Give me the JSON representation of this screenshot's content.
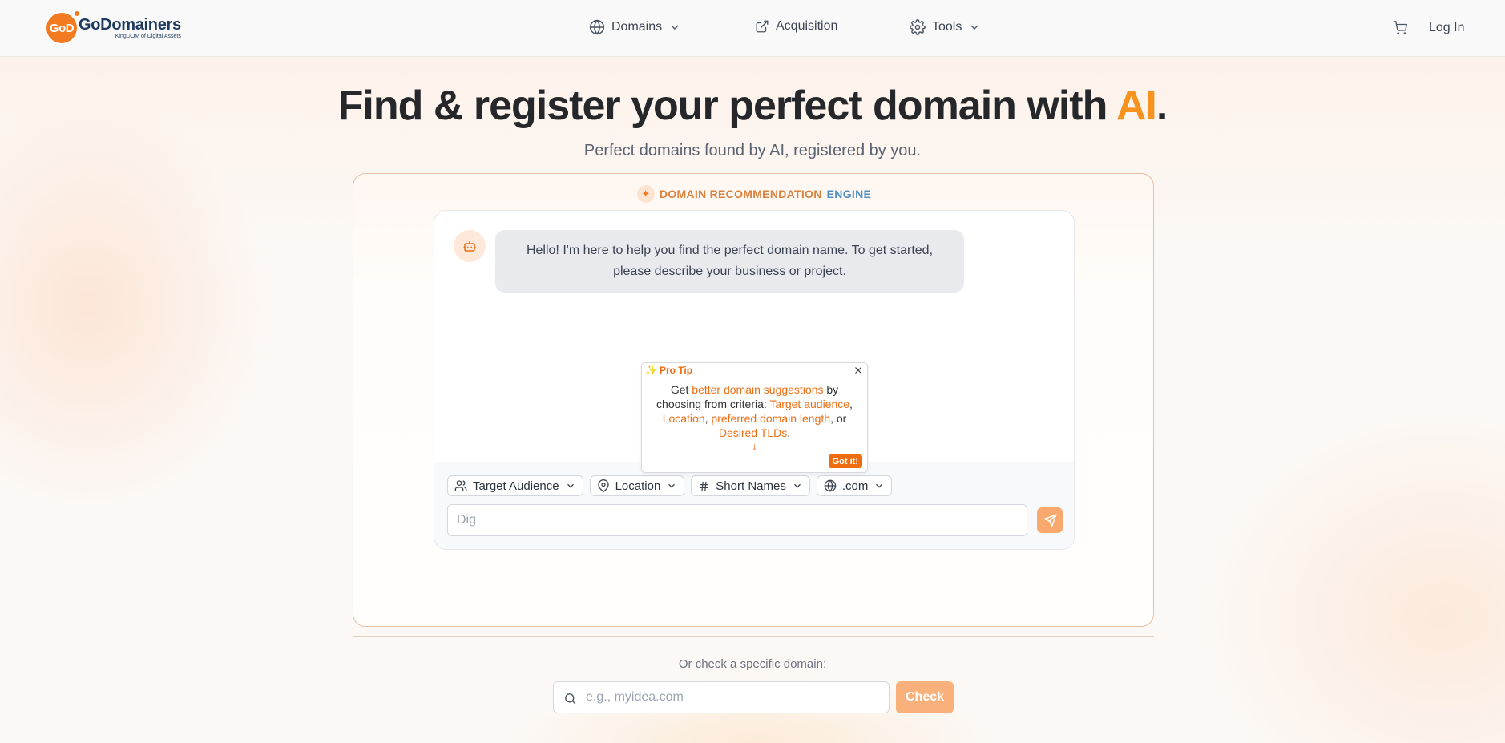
{
  "brand": {
    "badge": "GoD",
    "name": "GoDomainers",
    "tagline": "KingDOM of Digital Assets",
    "color": "#f27a21"
  },
  "nav": {
    "domains": "Domains",
    "acquisition": "Acquisition",
    "tools": "Tools",
    "login": "Log In"
  },
  "hero": {
    "title_prefix": "Find & register your perfect domain with ",
    "title_ai": "AI",
    "title_suffix": ".",
    "subtitle": "Perfect domains found by AI, registered by you."
  },
  "engine": {
    "label_part1": "DOMAIN RECOMMENDATION",
    "label_part2": "ENGINE"
  },
  "chat": {
    "bot_message": "Hello! I'm here to help you find the perfect domain name. To get started, please describe your business or project.",
    "input_placeholder": "Dig",
    "chips": {
      "audience": "Target Audience",
      "location": "Location",
      "length": "Short Names",
      "tld": ".com"
    }
  },
  "pro_tip": {
    "title": "Pro Tip",
    "t1": "Get ",
    "h1": "better domain suggestions",
    "t2": " by choosing from criteria: ",
    "h2": "Target audience",
    "t3": ", ",
    "h3": "Location",
    "t4": ", ",
    "h4": "preferred domain length",
    "t5": ", or ",
    "h5": "Desired TLDs",
    "t6": ".",
    "arrow": "↓",
    "button": "Got it!"
  },
  "domain_check": {
    "prompt": "Or check a specific domain:",
    "placeholder": "e.g., myidea.com",
    "button": "Check"
  },
  "colors": {
    "accent": "#f7921e",
    "engine_blue": "#4e8fc2",
    "send_button": "#f9a96e",
    "check_button": "#f9b07b"
  }
}
